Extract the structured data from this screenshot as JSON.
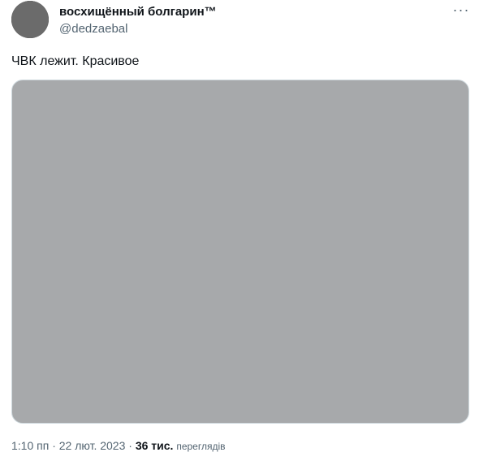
{
  "author": {
    "display_name": "восхищённый болгарин™",
    "handle": "@dedzaebal",
    "avatar_icon": "avatar-image"
  },
  "menu": {
    "more_icon": "more-dots-icon",
    "label": "···"
  },
  "tweet": {
    "text": "ЧВК лежит. Красивое"
  },
  "media": {
    "type": "photo"
  },
  "meta": {
    "time": "1:10 пп",
    "separator": " · ",
    "date": "22 лют. 2023",
    "separator2": " · ",
    "views_count": "36 тис.",
    "views_label": "переглядів"
  },
  "colors": {
    "text_primary": "#0f1419",
    "text_secondary": "#536471",
    "border": "#cfd9de",
    "media_placeholder": "#a7a9ab"
  }
}
